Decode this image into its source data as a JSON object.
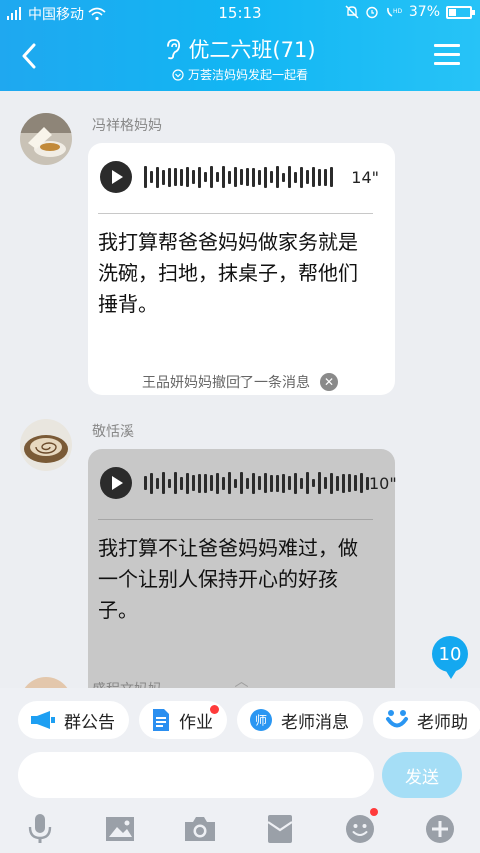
{
  "status_bar": {
    "carrier": "中国移动",
    "time": "15:13",
    "battery": "37%",
    "battery_level": 0.37
  },
  "header": {
    "title": "优二六班(71)",
    "subtitle": "万荟洁妈妈发起一起看"
  },
  "messages": [
    {
      "sender": "冯祥格妈妈",
      "duration": "14\"",
      "text": "我打算帮爸爸妈妈做家务就是洗碗，扫地，抹桌子，帮他们捶背。"
    },
    {
      "sender": "敬恬溪",
      "duration": "10\"",
      "text": "我打算不让爸爸妈妈难过，做一个让别人保持开心的好孩子。"
    },
    {
      "sender": "盛程文妈妈"
    }
  ],
  "notice": "王品妍妈妈撤回了一条消息",
  "unread_count": "10",
  "chips": [
    {
      "label": "群公告",
      "icon": "megaphone-icon"
    },
    {
      "label": "作业",
      "icon": "homework-doc-icon"
    },
    {
      "label": "老师消息",
      "icon": "teacher-badge-icon"
    },
    {
      "label": "老师助",
      "icon": "helper-icon"
    }
  ],
  "input": {
    "value": "",
    "send_label": "发送"
  },
  "toolbar": [
    "microphone-icon",
    "picture-icon",
    "camera-icon",
    "envelope-icon",
    "emoji-icon",
    "plus-icon"
  ],
  "colors": {
    "header": "#1fa8f0",
    "accent": "#14a8f0",
    "send_disabled": "#a5def6",
    "alert_dot": "#ff3b3b"
  }
}
